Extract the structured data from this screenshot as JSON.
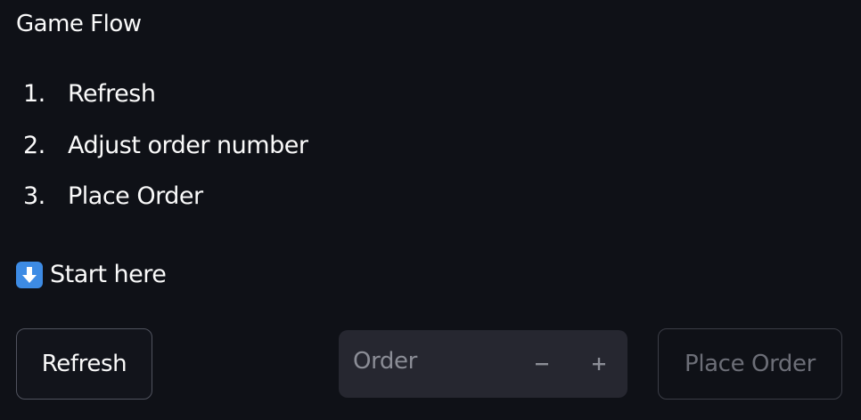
{
  "header": {
    "title": "Game Flow"
  },
  "steps": [
    {
      "number": "1.",
      "label": "Refresh"
    },
    {
      "number": "2.",
      "label": "Adjust order number"
    },
    {
      "number": "3.",
      "label": "Place Order"
    }
  ],
  "start": {
    "icon": "down-arrow-icon",
    "label": "Start here"
  },
  "controls": {
    "refresh_label": "Refresh",
    "order_placeholder": "Order",
    "minus_symbol": "−",
    "plus_symbol": "+",
    "place_order_label": "Place Order"
  },
  "colors": {
    "background": "#0f1117",
    "text": "#fafafa",
    "input_background": "#262730",
    "disabled_text": "#6c6e77",
    "icon_blue": "#3d8be4"
  }
}
